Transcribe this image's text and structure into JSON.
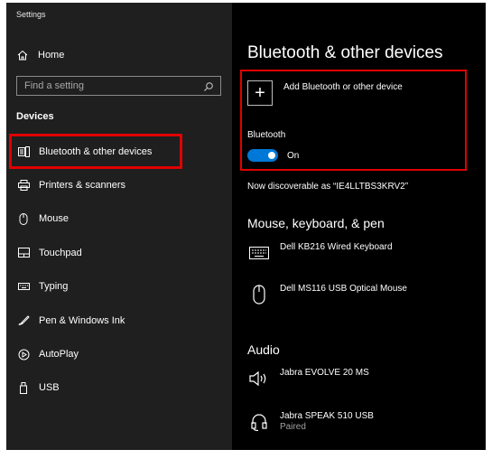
{
  "window": {
    "title": "Settings"
  },
  "sidebar": {
    "home_label": "Home",
    "search_placeholder": "Find a setting",
    "section_title": "Devices",
    "items": [
      {
        "label": "Bluetooth & other devices",
        "icon": "bluetooth-devices-icon",
        "selected": true
      },
      {
        "label": "Printers & scanners",
        "icon": "printer-icon"
      },
      {
        "label": "Mouse",
        "icon": "mouse-icon"
      },
      {
        "label": "Touchpad",
        "icon": "touchpad-icon"
      },
      {
        "label": "Typing",
        "icon": "keyboard-icon"
      },
      {
        "label": "Pen & Windows Ink",
        "icon": "pen-icon"
      },
      {
        "label": "AutoPlay",
        "icon": "autoplay-icon"
      },
      {
        "label": "USB",
        "icon": "usb-icon"
      }
    ]
  },
  "main": {
    "title": "Bluetooth & other devices",
    "add_device_label": "Add Bluetooth or other device",
    "bluetooth_label": "Bluetooth",
    "bluetooth_state": "On",
    "discoverable_text": "Now discoverable as “IE4LLTBS3KRV2”",
    "mouse_section_title": "Mouse, keyboard, & pen",
    "mouse_devices": [
      {
        "name": "Dell KB216 Wired Keyboard",
        "icon": "keyboard-icon"
      },
      {
        "name": "Dell MS116 USB Optical Mouse",
        "icon": "mouse-icon"
      }
    ],
    "audio_section_title": "Audio",
    "audio_devices": [
      {
        "name": "Jabra EVOLVE 20 MS",
        "icon": "speaker-icon"
      },
      {
        "name": "Jabra SPEAK 510 USB",
        "status": "Paired",
        "icon": "headset-icon"
      }
    ]
  },
  "colors": {
    "accent": "#0078d7",
    "highlight": "#e00000",
    "sidebar_bg": "#1f1f1f",
    "main_bg": "#000000"
  }
}
